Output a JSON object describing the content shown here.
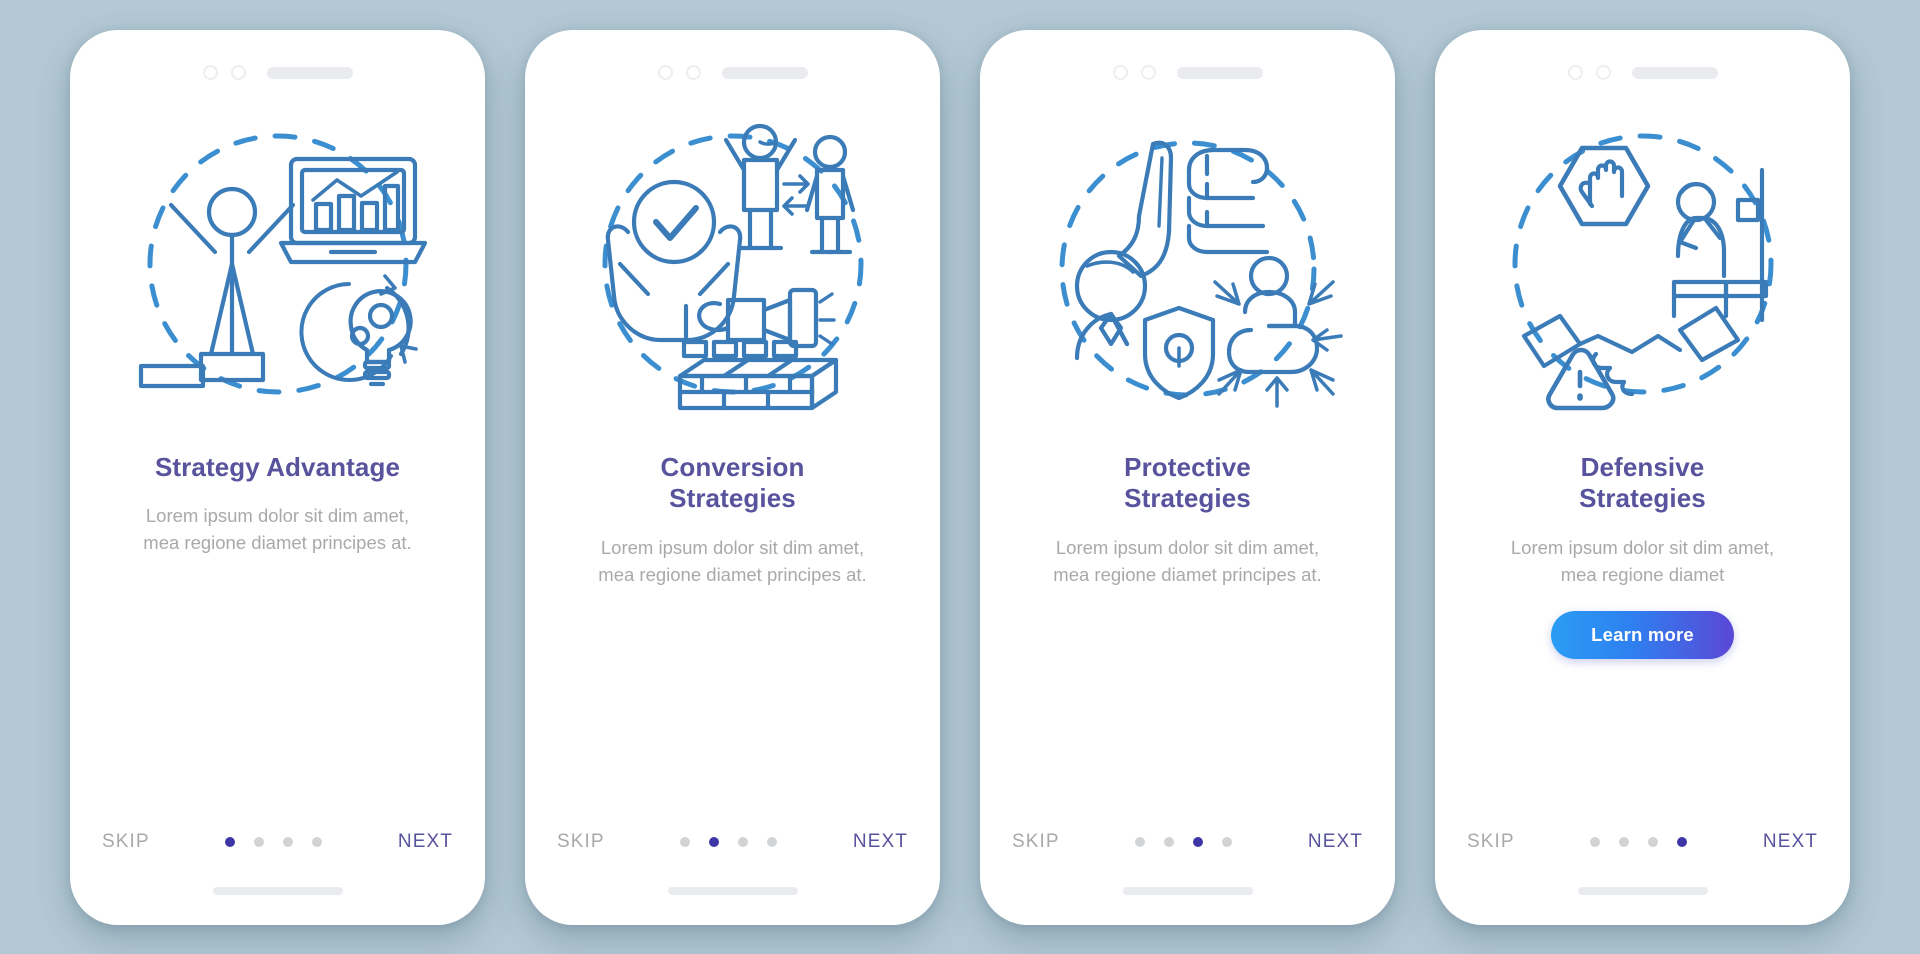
{
  "background_color": "#b3c9d4",
  "theme": {
    "title_color": "#58539c",
    "description_color": "#a9a9ab",
    "illustration_color": "#3b7cb8",
    "active_dot_color": "#3f36a8",
    "inactive_dot_color": "#d2d3d5",
    "next_color": "#58539c",
    "skip_color": "#a9a9ab",
    "cta_gradient_from": "#2a9df4",
    "cta_gradient_to": "#5b47d6"
  },
  "nav": {
    "skip_label": "SKIP",
    "next_label": "NEXT",
    "total_dots": 4
  },
  "screens": [
    {
      "id": "strategy-advantage",
      "title": "Strategy Advantage",
      "title_lines": [
        "Strategy",
        "Advantage"
      ],
      "description": "Lorem ipsum dolor sit dim amet, mea regione diamet principes at.",
      "active_index": 0,
      "cta": null,
      "illustration": {
        "name": "strategy-advantage-illustration",
        "elements": [
          "celebrating-person-on-podium",
          "laptop-with-bar-chart",
          "lightbulb-with-gears",
          "dashed-circle"
        ]
      }
    },
    {
      "id": "conversion-strategies",
      "title": "Conversion Strategies",
      "title_lines": [
        "Conversion",
        "Strategies"
      ],
      "description": "Lorem ipsum dolor sit dim amet, mea regione diamet principes at.",
      "active_index": 1,
      "cta": null,
      "illustration": {
        "name": "conversion-strategies-illustration",
        "elements": [
          "hands-holding-checkmark",
          "two-people-with-exchange-arrows",
          "hand-with-hammer",
          "brick-wall",
          "dashed-circle"
        ]
      }
    },
    {
      "id": "protective-strategies",
      "title": "Protective Strategies",
      "title_lines": [
        "Protective",
        "Strategies"
      ],
      "description": "Lorem ipsum dolor sit dim amet, mea regione diamet principes at.",
      "active_index": 2,
      "cta": null,
      "illustration": {
        "name": "protective-strategies-illustration",
        "elements": [
          "open-hand-stop",
          "clenched-fist",
          "person-with-shield-and-lock",
          "crouching-person-with-arrows",
          "dashed-circle"
        ]
      }
    },
    {
      "id": "defensive-strategies",
      "title": "Defensive Strategies",
      "title_lines": [
        "Defensive",
        "Strategies"
      ],
      "description": "Lorem ipsum dolor sit dim amet, mea regione diamet",
      "active_index": 3,
      "cta": "Learn more",
      "illustration": {
        "name": "defensive-strategies-illustration",
        "elements": [
          "hand-in-hexagon-stop-sign",
          "handshake",
          "warning-triangle-exclamation",
          "sad-person-sitting-on-bed",
          "dashed-circle"
        ]
      }
    }
  ]
}
